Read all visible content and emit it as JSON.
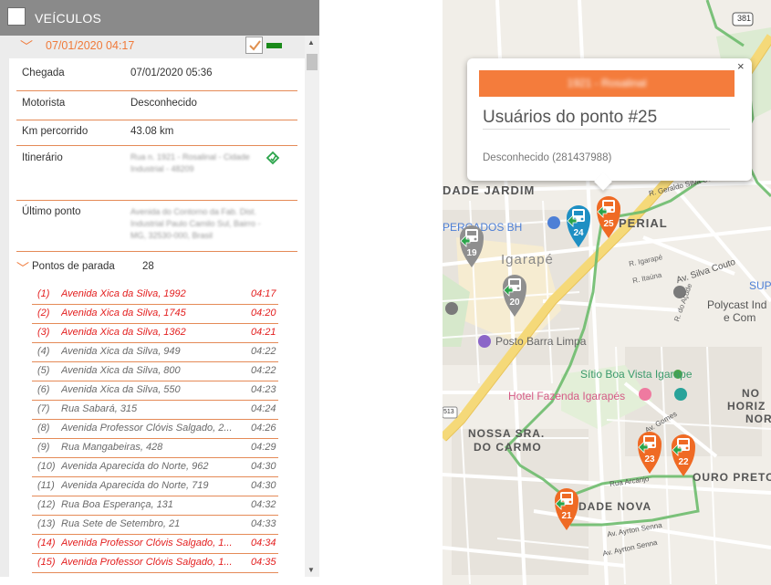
{
  "panel": {
    "title": "VEÍCULOS",
    "vehicle_date": "07/01/2020 04:17"
  },
  "details": {
    "chegada_label": "Chegada",
    "chegada_value": "07/01/2020 05:36",
    "motorista_label": "Motorista",
    "motorista_value": "Desconhecido",
    "km_label": "Km percorrido",
    "km_value": "43.08 km",
    "itinerario_label": "Itinerário",
    "ultimo_label": "Último ponto",
    "ultimo_value": "Avenida do Contorno da Fab. Dist. Industrial Paulo Camilo Sul, Bairro - MG, 32530-000, Brasil"
  },
  "stops": {
    "label": "Pontos de parada",
    "count": "28",
    "items": [
      {
        "n": "(1)",
        "addr": "Avenida Xica da Silva, 1992",
        "time": "04:17",
        "red": true
      },
      {
        "n": "(2)",
        "addr": "Avenida Xica da Silva, 1745",
        "time": "04:20",
        "red": true
      },
      {
        "n": "(3)",
        "addr": "Avenida Xica da Silva, 1362",
        "time": "04:21",
        "red": true
      },
      {
        "n": "(4)",
        "addr": "Avenida Xica da Silva, 949",
        "time": "04:22",
        "red": false
      },
      {
        "n": "(5)",
        "addr": "Avenida Xica da Silva, 800",
        "time": "04:22",
        "red": false
      },
      {
        "n": "(6)",
        "addr": "Avenida Xica da Silva, 550",
        "time": "04:23",
        "red": false
      },
      {
        "n": "(7)",
        "addr": "Rua Sabará, 315",
        "time": "04:24",
        "red": false
      },
      {
        "n": "(8)",
        "addr": "Avenida Professor Clóvis Salgado, 2...",
        "time": "04:26",
        "red": false
      },
      {
        "n": "(9)",
        "addr": "Rua Mangabeiras, 428",
        "time": "04:29",
        "red": false
      },
      {
        "n": "(10)",
        "addr": "Avenida Aparecida do Norte, 962",
        "time": "04:30",
        "red": false
      },
      {
        "n": "(11)",
        "addr": "Avenida Aparecida do Norte, 719",
        "time": "04:30",
        "red": false
      },
      {
        "n": "(12)",
        "addr": "Rua Boa Esperança, 131",
        "time": "04:32",
        "red": false
      },
      {
        "n": "(13)",
        "addr": "Rua Sete de Setembro, 21",
        "time": "04:33",
        "red": false
      },
      {
        "n": "(14)",
        "addr": "Avenida Professor Clóvis Salgado, 1...",
        "time": "04:34",
        "red": true
      },
      {
        "n": "(15)",
        "addr": "Avenida Professor Clóvis Salgado, 1...",
        "time": "04:35",
        "red": true
      }
    ]
  },
  "popup": {
    "title": "Usuários do ponto #25",
    "user": "Desconhecido (281437988)",
    "close": "×"
  },
  "map": {
    "labels": {
      "shield": "381",
      "dade_jardim": "DADE JARDIM",
      "imperial": "PERIAL",
      "supercados": "PERCADOS BH",
      "igarape": "Igarapé",
      "r_igarape": "R. Igarapé",
      "r_itauna": "R. Itaúna",
      "av_silva_couto": "Av. Silva Couto",
      "sup": "SUP",
      "polycast": "Polycast Ind",
      "polycast2": "e Com",
      "r_acude": "R. do Açude",
      "posto": "Posto Barra Limpa",
      "sitio": "Sítio Boa Vista Igarape",
      "hotel": "Hotel Fazenda Igarapés",
      "nossa1": "NOSSA SRA.",
      "nossa2": "DO CARMO",
      "no": "NO",
      "horiz": "HORIZ",
      "nor": "NOR",
      "ouro": "OURO PRETO",
      "dade_nova": "DADE NOVA",
      "rua_arcanjo": "Rua Arcanjo",
      "av_airton": "Av. Ayrton Senna",
      "av_ayrton2": "Av. Ayrton Senna",
      "r_geraldo": "R. Geraldo Silva Couto",
      "av_gomes": "Av. Gomes",
      "shield513": "513"
    },
    "pins": [
      {
        "id": "25",
        "color": "#ef6a24"
      },
      {
        "id": "24",
        "color": "#1e8fc3"
      },
      {
        "id": "19",
        "color": "#8f8f8f"
      },
      {
        "id": "20",
        "color": "#8f8f8f"
      },
      {
        "id": "23",
        "color": "#ef6a24"
      },
      {
        "id": "22",
        "color": "#ef6a24"
      },
      {
        "id": "21",
        "color": "#ef6a24"
      }
    ]
  },
  "colors": {
    "accent": "#f07a3a",
    "red_stop": "#e31e1e",
    "header": "#8a8a8a",
    "route": "#6dbb6d"
  }
}
